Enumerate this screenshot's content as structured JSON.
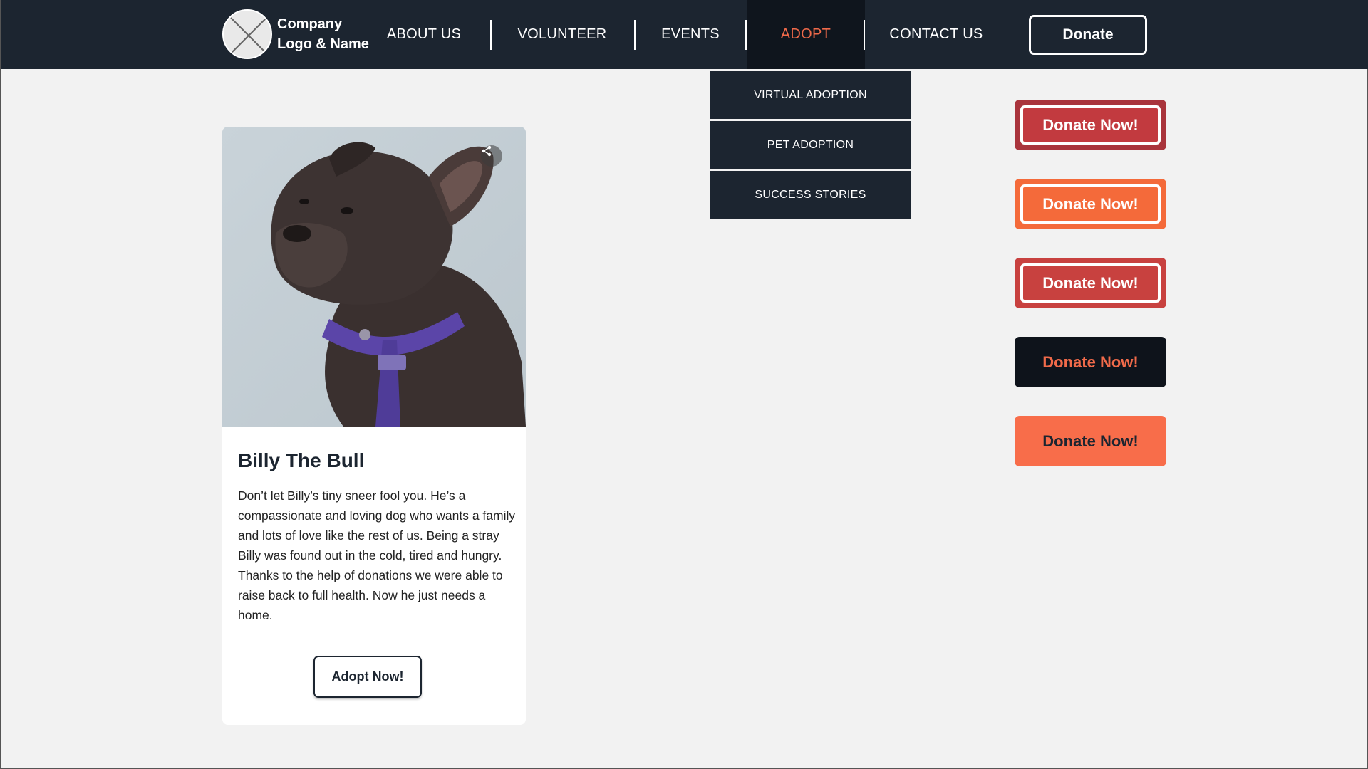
{
  "header": {
    "logo_line1": "Company",
    "logo_line2": "Logo & Name",
    "nav": [
      {
        "label": "ABOUT US"
      },
      {
        "label": "VOLUNTEER"
      },
      {
        "label": "EVENTS"
      },
      {
        "label": "ADOPT"
      },
      {
        "label": "CONTACT US"
      }
    ],
    "donate_label": "Donate"
  },
  "dropdown": {
    "items": [
      {
        "label": "VIRTUAL ADOPTION"
      },
      {
        "label": "PET ADOPTION"
      },
      {
        "label": "SUCCESS STORIES"
      }
    ]
  },
  "card": {
    "title": "Billy The Bull",
    "description": "Don’t let Billy’s tiny sneer fool you. He’s a compassionate and loving dog who wants a family and lots of love like the rest of us. Being a stray Billy was found out in the cold, tired and hungry. Thanks to the help of donations we were able to raise back to full health. Now he just needs a home.",
    "adopt_label": "Adopt Now!"
  },
  "donate_buttons": [
    {
      "label": "Donate Now!"
    },
    {
      "label": "Donate Now!"
    },
    {
      "label": "Donate Now!"
    },
    {
      "label": "Donate Now!"
    },
    {
      "label": "Donate Now!"
    }
  ],
  "colors": {
    "header_bg": "#1c2530",
    "accent": "#f06a4a",
    "page_bg": "#f2f2f2"
  }
}
